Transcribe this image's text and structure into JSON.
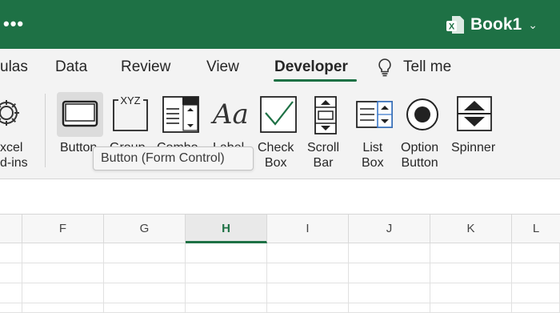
{
  "titlebar": {
    "menu_dots": "•••",
    "workbook_name": "Book1",
    "chevron": "⌄",
    "accent": "#1e7145"
  },
  "tabs": [
    {
      "label": "ulas"
    },
    {
      "label": "Data"
    },
    {
      "label": "Review"
    },
    {
      "label": "View"
    },
    {
      "label": "Developer",
      "active": true
    },
    {
      "label": "Tell me"
    }
  ],
  "ribbon": {
    "addins": {
      "line1": "xcel",
      "line2": "d-ins"
    },
    "controls": [
      {
        "line1": "Button",
        "line2": ""
      },
      {
        "line1": "Group",
        "line2": ""
      },
      {
        "line1": "Combo",
        "line2": ""
      },
      {
        "line1": "Label",
        "line2": ""
      },
      {
        "line1": "Check",
        "line2": "Box"
      },
      {
        "line1": "Scroll",
        "line2": "Bar"
      },
      {
        "line1": "List",
        "line2": "Box"
      },
      {
        "line1": "Option",
        "line2": "Button"
      },
      {
        "line1": "Spinner",
        "line2": ""
      }
    ],
    "group_box_text": "XYZ",
    "label_icon_text": "Aa"
  },
  "tooltip": "Button (Form Control)",
  "columns": [
    "F",
    "G",
    "H",
    "I",
    "J",
    "K",
    "L"
  ],
  "active_column": "H"
}
